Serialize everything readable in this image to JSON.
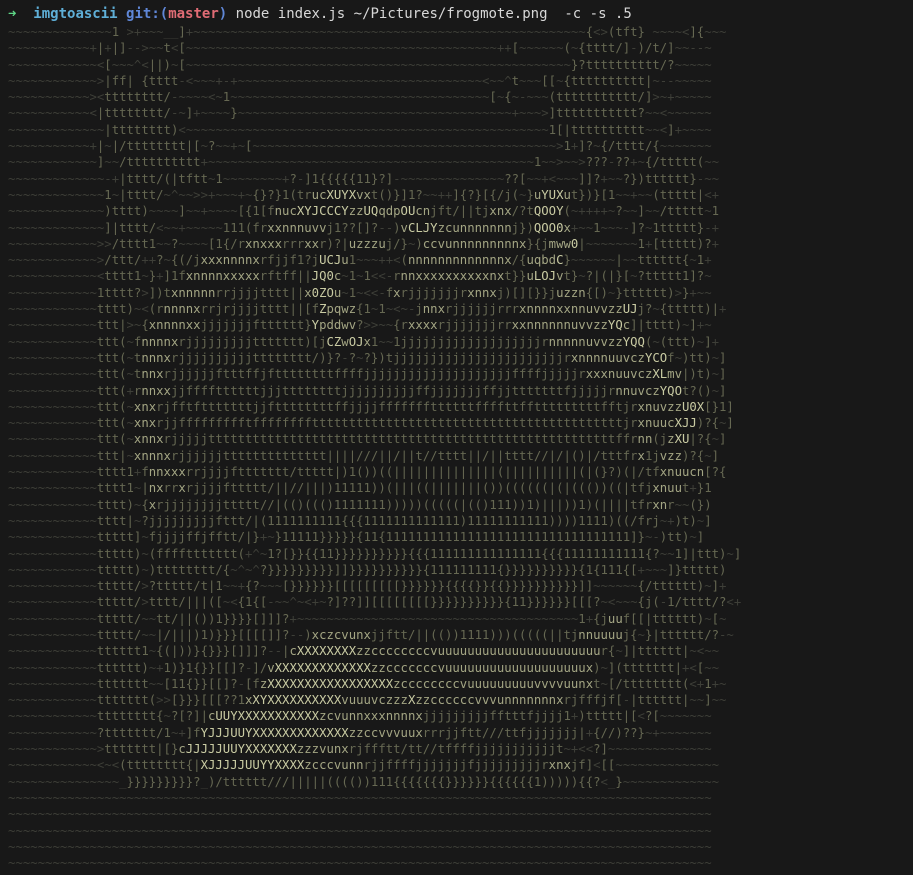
{
  "prompt": {
    "arrow": "➜",
    "directory": "imgtoascii",
    "git_label": "git:",
    "branch_open": "(",
    "branch": "master",
    "branch_close": ")",
    "command": "node index.js ~/Pictures/frogmote.png  -c -s .5"
  },
  "colors": {
    "background": "#181818",
    "arrow": "#5fd787",
    "directory": "#5fafd7",
    "git": "#5f87d7",
    "branch": "#e06c75",
    "ascii_dark": "#3e3f38",
    "ascii_mid": "#666852",
    "ascii_base": "#85876a",
    "ascii_bright": "#a3a583",
    "ascii_highlight": "#c9cba3"
  },
  "ascii_art": [
    "~~~~~~~~~~~~~~1 >+~~~__]+~~~~~~~~~~~~~~~~~~~~~~~~~~~~~~~~~~~~~~~~~~~~~~~~~~~~~{<>(tft} ~~~~<]{~~~",
    "~~~~~~~~~~~+|+|]-->~~t<[~~~~~~~~~~~~~~~~~~~~~~~~~~~~~~~~~~~~~~~~~~++[~~~~~~(~{tttt/]-)/t/]~~--~",
    "~~~~~~~~~~~~<[~~~^<||)~[~~~~~~~~~~~~~~~~~~~~~~~~~~~~~~~~~~~~~~~~~~~~~~~~~~~~}?tttttttttt/?~~~~~",
    "~~~~~~~~~~~~>|ff| {tttt-<~~~+-+~~~~~~~~~~~~~~~~~~~~~~~~~~~~~~~~~<~~^t~~~[[~{tttttttttt|~--~~~~~",
    "~~~~~~~~~~~><tttttttt/-~~~~<~1~~~~~~~~~~~~~~~~~~~~~~~~~~~~~~~~~~~[~{~-~~~(ttttttttttt/]>~+~~~~~",
    "~~~~~~~~~~~<|tttttttt/-~]+~~~~}~~~~~~~~~~~~~~~~~~~~~~~~~~~~~~~~~~~~~+~~~>]ttttttttttt?~~<~~~~~~",
    "~~~~~~~~~~~~~|tttttttt)<~~~~~~~~~~~~~~~~~~~~~~~~~~~~~~~~~~~~~~~~~~~~~~~~~1[|tttttttttt~~<]+~~~~",
    "~~~~~~~~~~~+|~|/tttttttt|[~?~~+~[~~~~~~~~~~~~~~~~~~~~~~~~~~~~~~~~~~~~~~~~~>1+]?~{/tttt/{~~~~~~~",
    "~~~~~~~~~~~~]~~/tttttttttt+~~~~~~~~~~~~~~~~~~~~~~~~~~~~~~~~~~~~~~~~~~~~1~~>~~>???-??+~{/ttttt(~~",
    "~~~~~~~~~~~~~-+|tttt/(|tftt~1~~~~~~~~+?-]1{{{{{11}?]-~~~~~~~~~~~~~~??[~~+<~~~]]?+~~?})tttttt}-~~",
    "~~~~~~~~~~~~~1~|tttt/~^~~>>+~~~+~{}?}1(trucXUYXvxt()}]1?~~++]{?}[{/j(~}uYUXut})}[1~~+~~(ttttt|<+",
    "~~~~~~~~~~~~~)tttt)~~~~]~~+~~~~[{1[fnucXYJCCCYzzUQqdpOUcnjft/||tjxnx/?tQOOY(~++++~?~~]~~/ttttt~1",
    "~~~~~~~~~~~~~]|tttt/<~~+~~~~~111(frxxnnnuvvj1??[]?--)vCLJYzcunnnnnnnj})QOO0x+~~1~~~-]?~1ttttt}-+",
    "~~~~~~~~~~~~>>/tttt1~~?~~~~[1{/rxnxxxrrrxxr)?|uzzzuj/}~)ccvunnnnnnnnnx}{jmww0|~~~~~~~1+[ttttt)?+",
    "~~~~~~~~~~~~>/ttt/++?~{(/jxxxnnnnxrfjjf1?jUCJu1~~~++<(nnnnnnnnnnnnnx/{uqbdC}~~~~~~|~~tttttt{~1+",
    "~~~~~~~~~~~~<tttt1~}+]1fxnnnnxxxxxrftff||JQ0c~1~1<<-rnnxxxxxxxxxxnxt}}uLOJvt}~?|(|}[~?ttttt1]?~",
    "~~~~~~~~~~~~1tttt?>])txnnnnnrrjjjjtttt||x0ZOu~1~<<-fxrjjjjjjjrxnnxj)[][}}juzzn{[)~}tttttt)>}+~~",
    "~~~~~~~~~~~~tttt)~<(rnnnnxrrjrjjjjtttt||[fZpqwz{1~1~<~-jnnxrjjjjjjrrrxnnnnxxnnuvvzzUJj?~{ttttt)|+",
    "~~~~~~~~~~~~ttt|>~{xnnnnxxjjjjjjjftttttt}Ypddwv?>>~~{rxxxxrjjjjjjjrrxxnnnnnnuvvzzYQc]|tttt)~]+~",
    "~~~~~~~~~~~~ttt(~fnnnnxrjjjjjjjjjttttttt)[jCZwOJx1~~1jjjjjjjjjjjjjjjjjjjrnnnnnuvvzzYQQ(~(ttt)~]+",
    "~~~~~~~~~~~~ttt(~tnnnxrjjjjjjjjjjtttttttt/)}?-?~?})tjjjjjjjjjjjjjjjjjjjjjjjrxnnnnuuvczYCOf~)tt)~]",
    "~~~~~~~~~~~~ttt(~tnnxrjjjjjjftttffjfttttttttffffjjjjjjjjjjjjjjjjjjjjffffjjjjjrxxxnuuvczXLmv|)t)~]",
    "~~~~~~~~~~~~ttt(+rnnxxjjffffttttttjjjttttttttjjjjjjjjjjffjjjjjjjffjjtttttttfjjjjjrnnuvczYQOt?()~]",
    "~~~~~~~~~~~~ttt(~xnxrjfftftttttttjjfttttttttffjjjjfffffffttttttffffttfftttttttttfftjrxnuvzzU0X[}1]",
    "~~~~~~~~~~~~ttt(~xnxrjjffffffffftffffffffttttttttttttttttttttttttttttttttttttttttttjrxnuucXJJ)?{~]",
    "~~~~~~~~~~~~ttt(~xnnxrjjjjjtttttttttttttttttttttttttttttttttttttttttttttttttttttttffrnn(jzXU|?{~]",
    "~~~~~~~~~~~~ttt|~xnnnxrjjjjjjtttttttttttttt||||///||/||t//tttt||/||tttt//|/|()|/tttfrx1jvzz)?{~]",
    "~~~~~~~~~~~~tttt1+fnnxxxrrjjjjfttttttt/ttttt|)1())((||||||||||||||(||||||||||(|(}?)(|/tfxnuucn[?{",
    "~~~~~~~~~~~~tttt1~|nxrrxrjjjjfttttt/||//|||)11111))(|||((|||||||())((((((|(|((())((|tfjxnuut+}1",
    "~~~~~~~~~~~~tttt)~{xrjjjjjjjjttttt//|(()((()1111111)))))(((((|(()111))1)|||))1)(||||tfrxnr~~(})",
    "~~~~~~~~~~~~tttt|~?jjjjjjjjjfttt/|(1111111111{{{1111111111111)11111111111))))1111)((/frj~+)t)~]",
    "~~~~~~~~~~~~ttttt]~fjjjjffjfftt/|}+~}11111}}}}}{11{111111111111111111111111111111111]}~-)tt)~]",
    "~~~~~~~~~~~~ttttt)~(ffffttttttt(+^~1?[}}{{11}}}}}}}}}}{{{111111111111111{{{11111111111{?~~1]|ttt)~]",
    "~~~~~~~~~~~~ttttt)~)tttttttt/{~^~^?}}}}}}}}}]]}}}}}}}}}}{111111111{}}}}}}}}}}{1{111{[+~~~]}ttttt)",
    "~~~~~~~~~~~~ttttt/>?ttttt/t|1~~+{?~~~[}}}}}}[[[[[[[[[}}}}}}{{{{}}{{}}}}}}}}}}]]~~~~~~{/tttttt)~]+",
    "~~~~~~~~~~~~ttttt/>tttt/|||([~<{1{[-~~^~<+~?]??]][[[[[[[[}}}}}}}}}}{11}}}}}}[[[?~<~~~{j(-1/tttt/?<+",
    "~~~~~~~~~~~~ttttt/~~tt/||())1}}}}[]]]?+~~~~~~~~~~~~~~~~~~~~~~~~~~~~~~~~~~~~~~1+{juuf[[|tttttt)~[~",
    "~~~~~~~~~~~~ttttt/~~|/|||)1)}}}[[[[]]?--)xczcvunxjjftt/||(())1111)))(((((||tjnnuuuuj{~}|tttttt/?-~",
    "~~~~~~~~~~~~tttttt1~{(|))}{}}}[]]]?--|cXXXXXXXXzzccccccccvuuuuuuuuuuuuuuuuuuuuuur{~]|tttttt|~<~~",
    "~~~~~~~~~~~~tttttt)~+1)}1{}}[[]?-]/vXXXXXXXXXXXXXzzcccccccvuuuuuuuuuuuuuuuuuuux)~](ttttttt|+<[~~",
    "~~~~~~~~~~~~ttttttt~~[11{}}[[]?-[fzXXXXXXXXXXXXXXXXXzccccccccvuuuuuuuuuvvvvuunxt~[/tttttttt(<+1+~",
    "~~~~~~~~~~~~ttttttt(>>[}}}[[[??1xXYXXXXXXXXXXvuuuvczzzXzzccccccvvvunnnnnnnxrjfffjf[-|tttttt|~~]~~",
    "~~~~~~~~~~~~tttttttt{~?[?]|cUUYXXXXXXXXXXXzcvunnxxxnnnnxjjjjjjjjjfftttfjjjj1+)ttttt|[<?[~~~~~~~",
    "~~~~~~~~~~~~?ttttttt/1~+]fYJJJUUYXXXXXXXXXXXXXzzccvvvuuxrrrjjftt///ttfjjjjjjj|+{//)??}~+~~~~~~~",
    "~~~~~~~~~~~~>ttttttt|[}cJJJJJUUYXXXXXXXzzzvunxrjffftt/tt//tffffjjjjjjjjjjjt~+<<?]~~~~~~~~~~~~~~",
    "~~~~~~~~~~~~<~<(tttttttt{|XJJJJJUUYYXXXXzcccvunnrjjffffjjjjjjjfjjjjjjjjjrxnxjf]<[[~~~~~~~~~~~~~~",
    "~~~~~~~~~~~~~~~_}}}}}}}}}?_)/tttttt///|||||(((())111{{{{{{{}}}}}}{{{{{{1))))){{?<_}~~~~~~~~~~~~~",
    "~~~~~~~~~~~~~~~~~~~~~~~~~~~~~~~~~~~~~~~~~~~~~~~~~~~~~~~~~~~~~~~~~~~~~~~~~~~~~~~~~~~~~~~~~~~~~~~",
    "~~~~~~~~~~~~~~~~~~~~~~~~~~~~~~~~~~~~~~~~~~~~~~~~~~~~~~~~~~~~~~~~~~~~~~~~~~~~~~~~~~~~~~~~~~~~~~~",
    "~~~~~~~~~~~~~~~~~~~~~~~~~~~~~~~~~~~~~~~~~~~~~~~~~~~~~~~~~~~~~~~~~~~~~~~~~~~~~~~~~~~~~~~~~~~~~~~",
    "~~~~~~~~~~~~~~~~~~~~~~~~~~~~~~~~~~~~~~~~~~~~~~~~~~~~~~~~~~~~~~~~~~~~~~~~~~~~~~~~~~~~~~~~~~~~~~~",
    "~~~~~~~~~~~~~~~~~~~~~~~~~~~~~~~~~~~~~~~~~~~~~~~~~~~~~~~~~~~~~~~~~~~~~~~~~~~~~~~~~~~~~~~~~~~~~~~"
  ]
}
